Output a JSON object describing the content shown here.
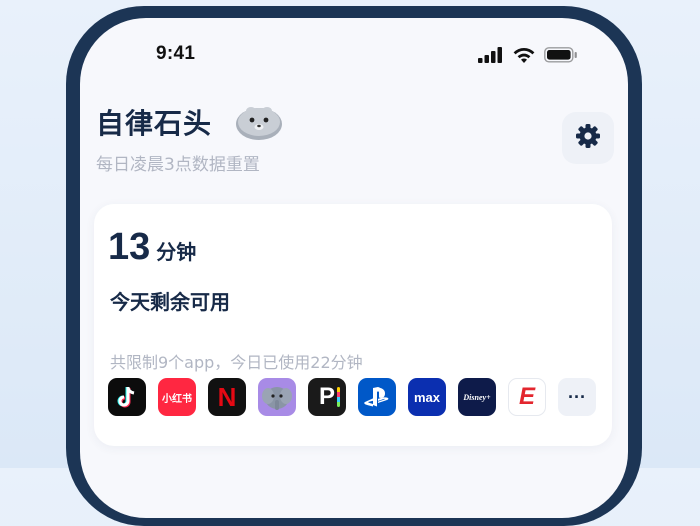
{
  "status_bar": {
    "time": "9:41"
  },
  "header": {
    "title": "自律石头",
    "subtitle": "每日凌晨3点数据重置",
    "settings_icon": "gear-icon",
    "mascot_icon": "seal-mascot-icon"
  },
  "card": {
    "minutes_value": "13",
    "minutes_unit": "分钟",
    "remaining_label": "今天剩余可用",
    "limit_summary": "共限制9个app，今日已使用22分钟",
    "apps": [
      {
        "name": "tiktok-icon",
        "label": "",
        "bg": "#0c0c0c"
      },
      {
        "name": "xiaohongshu-icon",
        "label": "小红书",
        "bg": "#ff2741"
      },
      {
        "name": "netflix-icon",
        "label": "N",
        "bg": "#111111"
      },
      {
        "name": "elephant-app-icon",
        "label": "",
        "bg": "#a88be6"
      },
      {
        "name": "p-app-icon",
        "label": "P",
        "bg": "#1a1a1a"
      },
      {
        "name": "playstation-icon",
        "label": "",
        "bg": "#0058c8"
      },
      {
        "name": "max-icon",
        "label": "max",
        "bg": "#0b2fb0"
      },
      {
        "name": "disney-plus-icon",
        "label": "Disney+",
        "bg": "#0e1b4a"
      },
      {
        "name": "espn-icon",
        "label": "E",
        "bg": "#ffffff"
      },
      {
        "name": "more-icon",
        "label": "···",
        "bg": "#eef1f7"
      }
    ]
  }
}
